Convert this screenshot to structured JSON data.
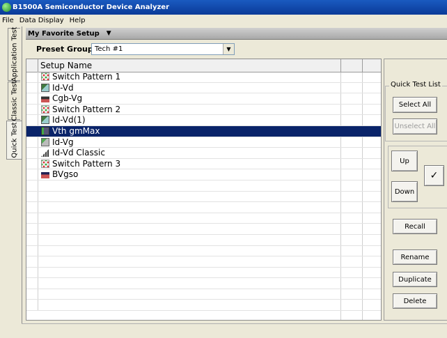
{
  "window": {
    "title": "B1500A Semiconductor Device Analyzer"
  },
  "menu": [
    "File",
    "Data Display",
    "Help"
  ],
  "tabs": [
    "Application Test",
    "Classic Test",
    "Quick Test"
  ],
  "section": {
    "title": "My Favorite Setup",
    "arrow": "▼"
  },
  "preset": {
    "label": "Preset Group:",
    "value": "Tech #1"
  },
  "grid": {
    "header": "Setup Name",
    "rows": [
      {
        "name": "Switch Pattern 1",
        "icon": "switch-pattern-icon"
      },
      {
        "name": "Id-Vd",
        "icon": "id-vd-icon"
      },
      {
        "name": "Cgb-Vg",
        "icon": "cv-icon"
      },
      {
        "name": "Switch Pattern 2",
        "icon": "switch-pattern-icon"
      },
      {
        "name": "Id-Vd(1)",
        "icon": "id-vd-icon"
      },
      {
        "name": "Vth gmMax",
        "icon": "vth-icon",
        "selected": true
      },
      {
        "name": "Id-Vg",
        "icon": "id-vg-icon"
      },
      {
        "name": "Id-Vd Classic",
        "icon": "classic-bars-icon"
      },
      {
        "name": "Switch Pattern 3",
        "icon": "switch-pattern-icon"
      },
      {
        "name": "BVgso",
        "icon": "bv-icon"
      }
    ]
  },
  "quick_test_list": {
    "legend": "Quick Test List",
    "select_all": "Select All",
    "unselect_all": "Unselect All"
  },
  "buttons": {
    "up": "Up",
    "down": "Down",
    "check": "✓",
    "recall": "Recall",
    "rename": "Rename",
    "duplicate": "Duplicate",
    "delete": "Delete"
  },
  "colors": {
    "selection": "#0a246a",
    "titlebar": "#0a3a98"
  }
}
